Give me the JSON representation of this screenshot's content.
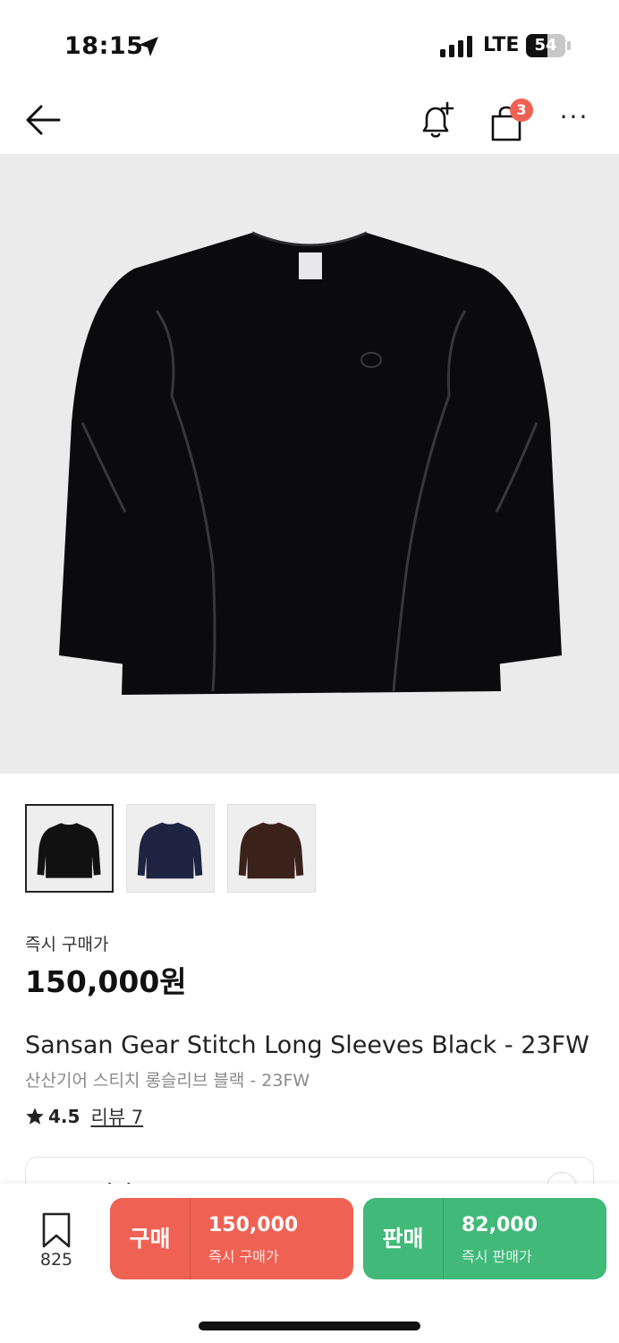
{
  "status_bar": {
    "time": "18:15",
    "network": "LTE",
    "battery_percent": "54",
    "battery_level": 0.54
  },
  "nav": {
    "back_icon": "arrow-left-icon",
    "alert_icon": "bell-plus-icon",
    "cart_icon": "shopping-bag-icon",
    "cart_badge": "3",
    "more_icon": "more-horizontal-icon",
    "more_glyph": "···"
  },
  "product": {
    "thumbnails": [
      {
        "color": "#111111",
        "selected": true
      },
      {
        "color": "#1d2340",
        "selected": false
      },
      {
        "color": "#3a221b",
        "selected": false
      }
    ],
    "price_label": "즉시 구매가",
    "price": "150,000원",
    "name_en": "Sansan Gear Stitch Long Sleeves Black - 23FW",
    "name_ko": "산산기어 스티치 롱슬리브 블랙 - 23FW",
    "rating": "4.5",
    "review_link": "리뷰 7"
  },
  "size_selector": {
    "label": "모든 사이즈"
  },
  "bottom_bar": {
    "bookmark_count": "825",
    "buy": {
      "kind": "구매",
      "price": "150,000",
      "sub": "즉시 구매가",
      "color": "#ef6253"
    },
    "sell": {
      "kind": "판매",
      "price": "82,000",
      "sub": "즉시 판매가",
      "color": "#41b979"
    }
  }
}
